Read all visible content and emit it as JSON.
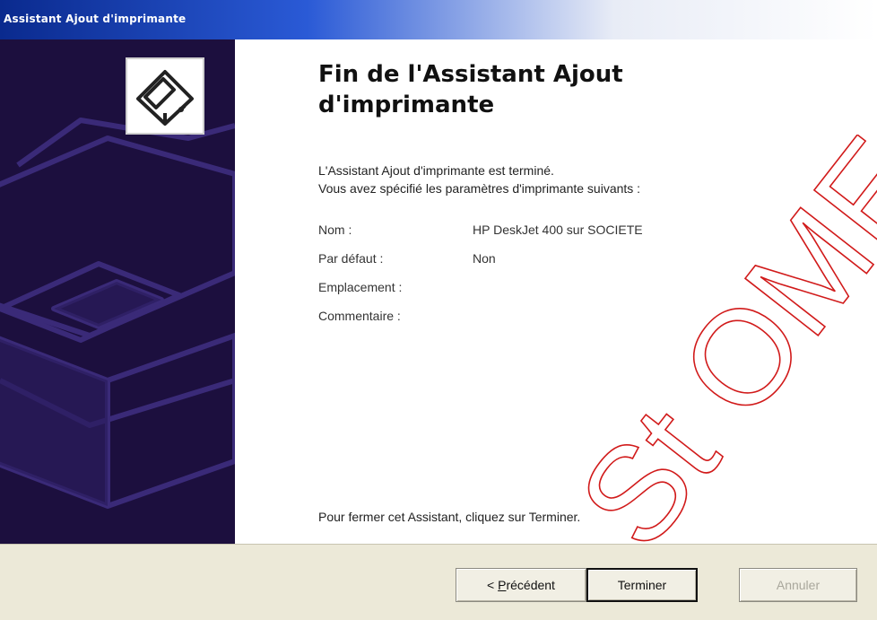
{
  "window": {
    "title": "Assistant Ajout d'imprimante"
  },
  "header": {
    "heading": "Fin de l'Assistant Ajout d'imprimante"
  },
  "intro": {
    "line1": "L'Assistant Ajout d'imprimante est terminé.",
    "line2": "Vous avez spécifié les paramètres d'imprimante suivants :"
  },
  "settings": [
    {
      "label": "Nom :",
      "value": "HP DeskJet 400 sur SOCIETE"
    },
    {
      "label": "Par défaut :",
      "value": "Non"
    },
    {
      "label": "Emplacement :",
      "value": ""
    },
    {
      "label": "Commentaire :",
      "value": ""
    }
  ],
  "closing": "Pour fermer cet Assistant, cliquez sur Terminer.",
  "buttons": {
    "back_prefix": "< ",
    "back_accel": "P",
    "back_rest": "récédent",
    "finish": "Terminer",
    "cancel": "Annuler"
  },
  "watermark": "St OME",
  "colors": {
    "sidepanel": "#1c0f3e",
    "titlebar": "#0a2a8e",
    "buttonbar": "#ece9d8"
  },
  "icons": {
    "logo": "printer-icon"
  }
}
